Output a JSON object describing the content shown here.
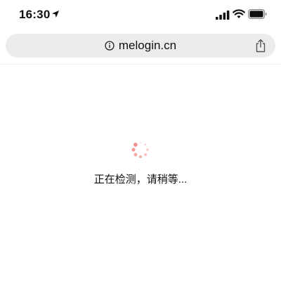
{
  "status_bar": {
    "time": "16:30",
    "icons": [
      "location-arrow-icon",
      "cellular-signal-icon",
      "wifi-icon",
      "battery-icon"
    ]
  },
  "browser": {
    "url": "melogin.cn",
    "address_icon": "info-icon",
    "share_icon": "share-icon"
  },
  "page": {
    "loading_text": "正在检测，请稍等...",
    "spinner_color": "#f08a85"
  }
}
